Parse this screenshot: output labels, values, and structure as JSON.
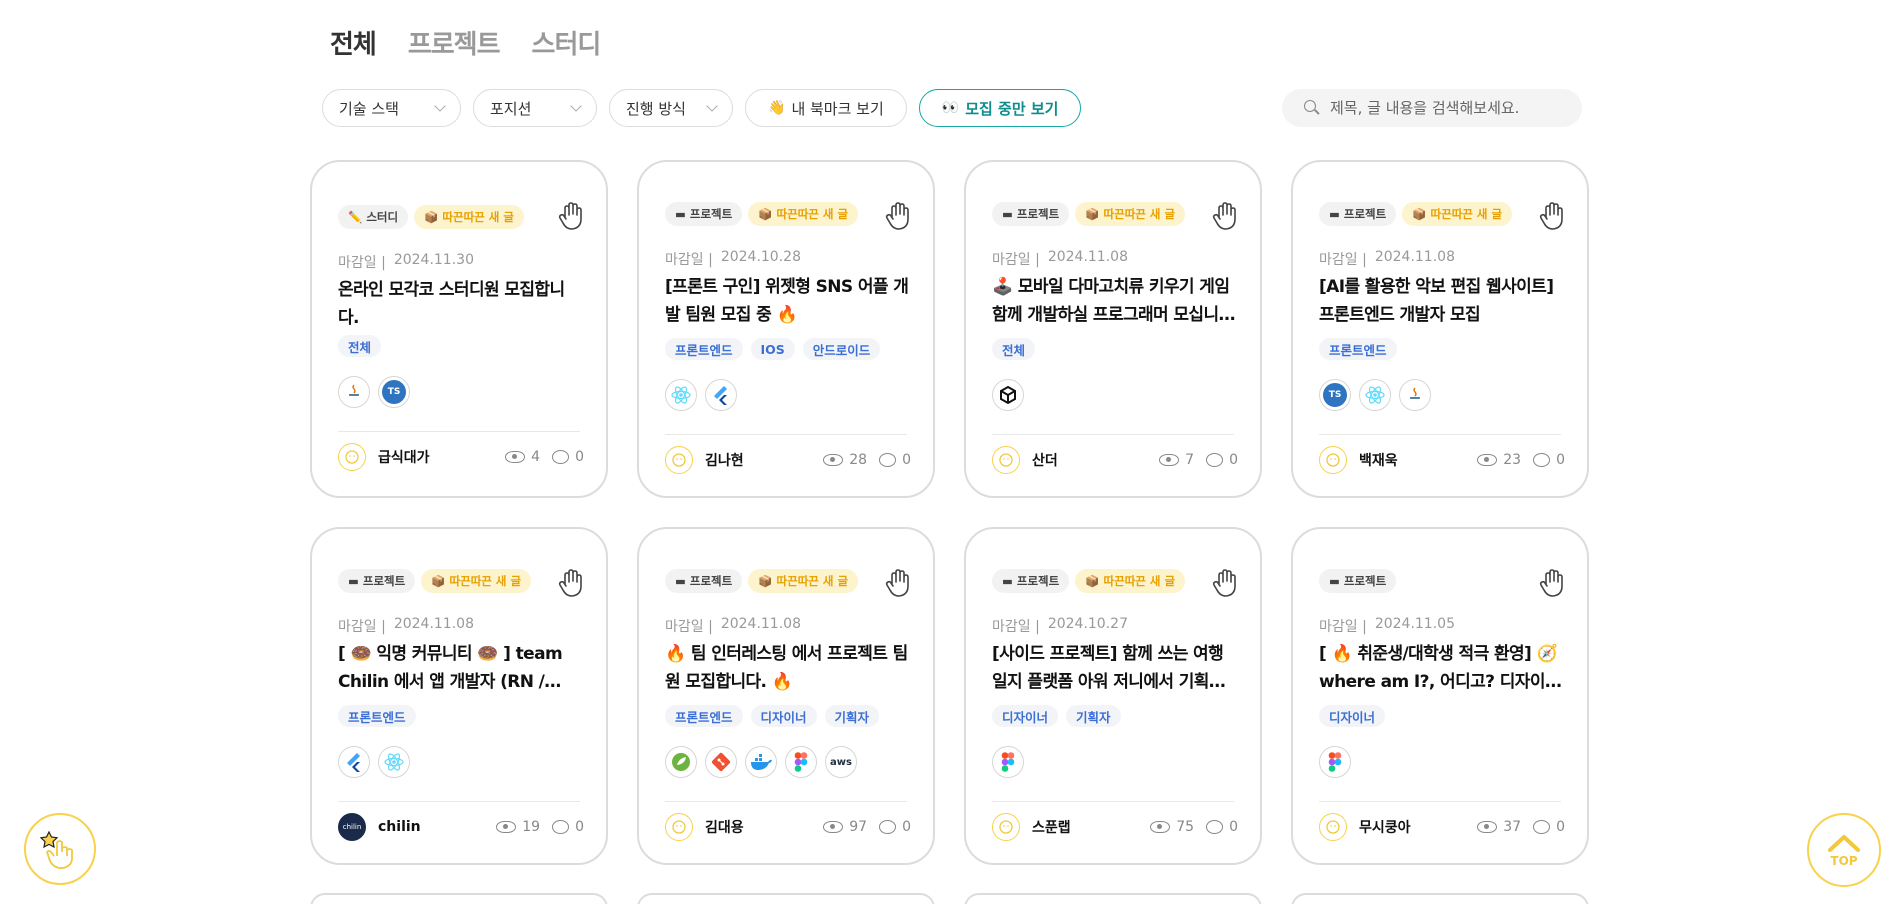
{
  "tabs": [
    "전체",
    "프로젝트",
    "스터디"
  ],
  "filters": {
    "tech_stack": "기술 스택",
    "position": "포지션",
    "method": "진행 방식",
    "bookmark": "내 북마크 보기",
    "recruiting": "모집 중만 보기"
  },
  "search": {
    "placeholder": "제목, 글 내용을 검색해보세요."
  },
  "colors": {
    "accent": "#16a6a6",
    "new_badge_bg": "#fdf3cd",
    "new_badge_text": "#e7a100",
    "position_text": "#3b6fd6"
  },
  "deadline_label": "마감일 |",
  "new_badge": "따끈따끈 새 글",
  "cards": [
    {
      "kind": "스터디",
      "kind_icon": "pencil-icon",
      "is_new": true,
      "deadline": "2024.11.30",
      "title": "온라인 모각코 스터디원 모집합니다.",
      "positions": [
        "전체"
      ],
      "stacks": [
        "java",
        "typescript"
      ],
      "author": "급식대가",
      "views": "4",
      "comments": "0"
    },
    {
      "kind": "프로젝트",
      "kind_icon": "folder-icon",
      "is_new": true,
      "deadline": "2024.10.28",
      "title": "[프론트 구인] 위젯형 SNS 어플 개발 팀원 모집 중 🔥",
      "positions": [
        "프론트엔드",
        "IOS",
        "안드로이드"
      ],
      "stacks": [
        "react",
        "flutter"
      ],
      "author": "김나현",
      "views": "28",
      "comments": "0"
    },
    {
      "kind": "프로젝트",
      "kind_icon": "folder-icon",
      "is_new": true,
      "deadline": "2024.11.08",
      "title": "🕹️ 모바일 다마고치류 키우기 게임 함께 개발하실 프로그래머 모십니다!",
      "positions": [
        "전체"
      ],
      "stacks": [
        "unity"
      ],
      "author": "산더",
      "views": "7",
      "comments": "0"
    },
    {
      "kind": "프로젝트",
      "kind_icon": "folder-icon",
      "is_new": true,
      "deadline": "2024.11.08",
      "title": "[AI를 활용한 악보 편집 웹사이트] 프론트엔드 개발자 모집",
      "positions": [
        "프론트엔드"
      ],
      "stacks": [
        "typescript",
        "react",
        "java"
      ],
      "author": "백재욱",
      "views": "23",
      "comments": "0"
    },
    {
      "kind": "프로젝트",
      "kind_icon": "folder-icon",
      "is_new": true,
      "deadline": "2024.11.08",
      "title": "[ 🍩 익명 커뮤니티 🍩 ] team Chilin 에서 앱 개발자 (RN / Flutter )를 모집합니다",
      "positions": [
        "프론트엔드"
      ],
      "stacks": [
        "flutter",
        "react"
      ],
      "author": "chilin",
      "views": "19",
      "comments": "0"
    },
    {
      "kind": "프로젝트",
      "kind_icon": "folder-icon",
      "is_new": true,
      "deadline": "2024.11.08",
      "title": "🔥 팀 인터레스팅 에서 프로젝트 팀원 모집합니다. 🔥",
      "positions": [
        "프론트엔드",
        "디자이너",
        "기획자"
      ],
      "stacks": [
        "spring",
        "git",
        "docker",
        "figma",
        "aws"
      ],
      "author": "김대용",
      "views": "97",
      "comments": "0"
    },
    {
      "kind": "프로젝트",
      "kind_icon": "folder-icon",
      "is_new": true,
      "deadline": "2024.10.27",
      "title": "[사이드 프로젝트] 함께 쓰는 여행일지 플랫폼 아워 저니에서 기획자와 디자이너를 모집합니다",
      "positions": [
        "디자이너",
        "기획자"
      ],
      "stacks": [
        "figma"
      ],
      "author": "스푼랩",
      "views": "75",
      "comments": "0"
    },
    {
      "kind": "프로젝트",
      "kind_icon": "folder-icon",
      "is_new": false,
      "deadline": "2024.11.05",
      "title": "[ 🔥 취준생/대학생 적극 환영] 🧭 where am I?, 어디고? 디자이너님 모십니다",
      "positions": [
        "디자이너"
      ],
      "stacks": [
        "figma"
      ],
      "author": "무시쿵아",
      "views": "37",
      "comments": "0"
    }
  ],
  "top_button": "TOP"
}
